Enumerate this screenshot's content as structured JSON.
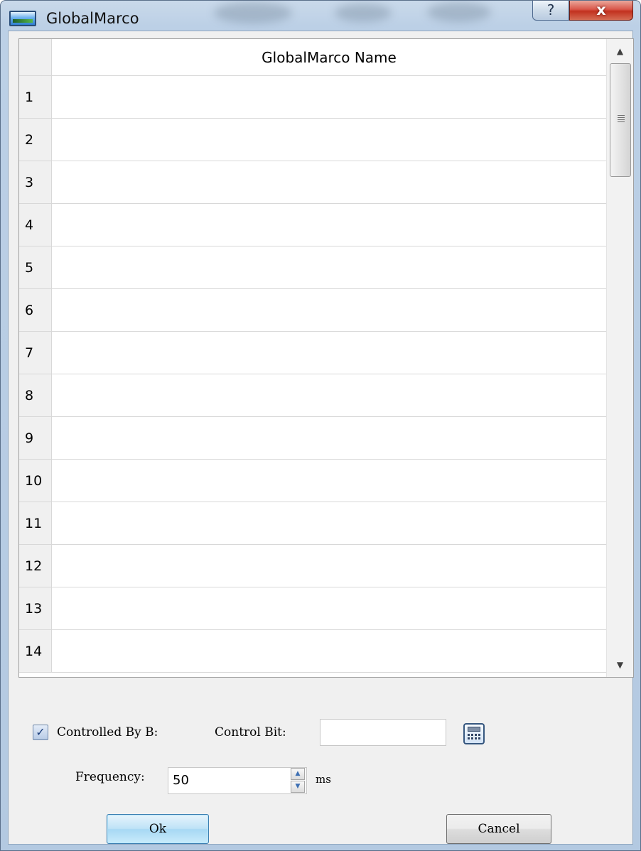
{
  "window": {
    "title": "GlobalMarco",
    "help_glyph": "?",
    "close_glyph": "x"
  },
  "table": {
    "column_header": "GlobalMarco Name",
    "rows": [
      {
        "num": "1",
        "name": ""
      },
      {
        "num": "2",
        "name": ""
      },
      {
        "num": "3",
        "name": ""
      },
      {
        "num": "4",
        "name": ""
      },
      {
        "num": "5",
        "name": ""
      },
      {
        "num": "6",
        "name": ""
      },
      {
        "num": "7",
        "name": ""
      },
      {
        "num": "8",
        "name": ""
      },
      {
        "num": "9",
        "name": ""
      },
      {
        "num": "10",
        "name": ""
      },
      {
        "num": "11",
        "name": ""
      },
      {
        "num": "12",
        "name": ""
      },
      {
        "num": "13",
        "name": ""
      },
      {
        "num": "14",
        "name": ""
      }
    ]
  },
  "controls": {
    "controlled_by_b": {
      "label": "Controlled By B:",
      "checked": true,
      "check_glyph": "✓"
    },
    "control_bit": {
      "label": "Control Bit:",
      "value": ""
    },
    "calculator_icon": "calculator-icon",
    "frequency": {
      "label": "Frequency:",
      "value": "50",
      "unit": "ms"
    },
    "spin_up_glyph": "▲",
    "spin_down_glyph": "▼"
  },
  "scrollbar": {
    "up_glyph": "▲",
    "down_glyph": "▼"
  },
  "buttons": {
    "ok": "Ok",
    "cancel": "Cancel"
  }
}
